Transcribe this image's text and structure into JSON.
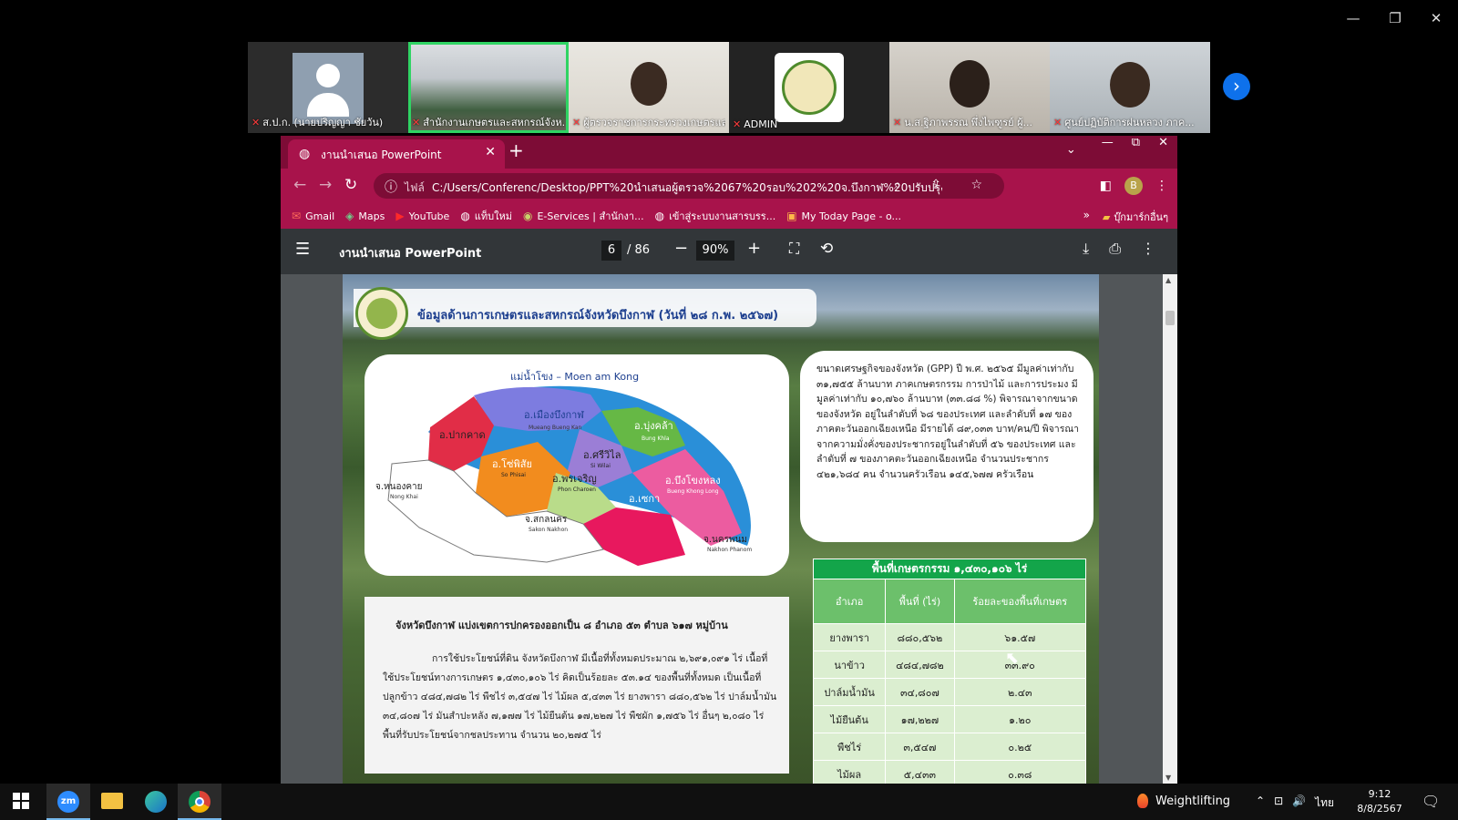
{
  "window_controls": {
    "minimize": "—",
    "restore": "❐",
    "close": "✕"
  },
  "participants": [
    {
      "name": "ส.ป.ก. (นายปริญญา ชัยวัน)"
    },
    {
      "name": "สำนักงานเกษตรและสหกรณ์จังห..."
    },
    {
      "name": "ผู้ตรวจราชการกระทรวงเกษตรแล..."
    },
    {
      "name": "ADMIN"
    },
    {
      "name": "น.ส.ฐิภาพรรณ พึ่งไพฑูรย์ ผู้..."
    },
    {
      "name": "ศูนย์ปฏิบัติการฝนหลวง ภาค..."
    }
  ],
  "next_icon": "›",
  "browser": {
    "tab_title": "งานนำเสนอ PowerPoint",
    "tab_close": "✕",
    "new_tab": "+",
    "tab_controls": {
      "dropdown": "⌄",
      "minimize": "—",
      "restore": "⧉",
      "close": "✕"
    },
    "nav": {
      "back": "←",
      "forward": "→",
      "reload": "↻"
    },
    "url_prefix": "ไฟล์",
    "url": "C:/Users/Conferenc/Desktop/PPT%20นำเสนอผู้ตรวจ%2067%20รอบ%202%20จ.บึงกาฬ%20ปรับปรุง.pdf",
    "url_icons": "⌕ ⇪ ☆",
    "profile_initial": "B",
    "bookmarks": [
      {
        "label": "Gmail",
        "icon": "✉"
      },
      {
        "label": "Maps",
        "icon": "◈"
      },
      {
        "label": "YouTube",
        "icon": "▶"
      },
      {
        "label": "แท็บใหม่",
        "icon": "◍"
      },
      {
        "label": "E-Services | สำนักงา...",
        "icon": "◉"
      },
      {
        "label": "เข้าสู่ระบบงานสารบรร...",
        "icon": "◍"
      },
      {
        "label": "My Today Page - o...",
        "icon": "▣"
      }
    ],
    "bookmarks_more": "»",
    "other_bookmarks": "บุ๊กมาร์กอื่นๆ"
  },
  "pdf": {
    "title": "งานนำเสนอ PowerPoint",
    "page_current": "6",
    "page_total": "/ 86",
    "zoom": "90%",
    "icons": {
      "menu": "☰",
      "zoom_out": "−",
      "zoom_in": "+",
      "fit": "⛶",
      "rotate": "⟲",
      "download": "⤓",
      "print": "⎙",
      "more": "⋮"
    }
  },
  "slide": {
    "heading": "ข้อมูลด้านการเกษตรและสหกรณ์จังหวัดบึงกาฬ (วันที่ ๒๘ ก.พ. ๒๕๖๗)",
    "map": {
      "river": "แม่น้ำโขง – Moen am Kong",
      "districts": [
        {
          "th": "อ.เมืองบึงกาฬ",
          "en": "Mueang Bueng Kan"
        },
        {
          "th": "อ.ปากคาด",
          "en": ""
        },
        {
          "th": "อ.บุ่งคล้า",
          "en": "Bung Khla"
        },
        {
          "th": "อ.ศรีวิไล",
          "en": "Si Wilai"
        },
        {
          "th": "อ.โซ่พิสัย",
          "en": "So Phisai"
        },
        {
          "th": "อ.พรเจริญ",
          "en": "Phon Charoen"
        },
        {
          "th": "อ.บึงโขงหลง",
          "en": "Bueng Khong Long"
        },
        {
          "th": "อ.เซกา",
          "en": ""
        }
      ],
      "neighbors": [
        {
          "th": "จ.หนองคาย",
          "en": "Nong Khai"
        },
        {
          "th": "จ.สกลนคร",
          "en": "Sakon Nakhon"
        },
        {
          "th": "จ.นครพนม",
          "en": "Nakhon Phanom"
        }
      ]
    },
    "gpp_text": "ขนาดเศรษฐกิจของจังหวัด (GPP) ปี พ.ศ. ๒๕๖๕ มีมูลค่าเท่ากับ ๓๑,๗๕๕ ล้านบาท ภาคเกษตรกรรม การป่าไม้ และการประมง มีมูลค่าเท่ากับ ๑๐,๗๖๐ ล้านบาท (๓๓.๘๘ %) พิจารณาจากขนาดของจังหวัด อยู่ในลำดับที่ ๖๘ ของประเทศ และลำดับที่ ๑๗ ของภาคตะวันออกเฉียงเหนือ มีรายได้ ๘๙,๐๓๓ บาท/คน/ปี พิจารณาจากความมั่งคั่งของประชากรอยู่ในลำดับที่ ๕๖ ของประเทศ และลำดับที่ ๗ ของภาคตะวันออกเฉียงเหนือ จำนวนประชากร ๔๒๑,๖๘๔ คน จำนวนครัวเรือน ๑๔๕,๖๗๗ ครัวเรือน",
    "table": {
      "caption": "พื้นที่เกษตรกรรม ๑,๔๓๐,๑๐๖ ไร่",
      "headers": [
        "อำเภอ",
        "พื้นที่ (ไร่)",
        "ร้อยละของพื้นที่เกษตร"
      ],
      "rows": [
        [
          "ยางพารา",
          "๘๘๐,๕๖๒",
          "๖๑.๕๗"
        ],
        [
          "นาข้าว",
          "๔๘๔,๗๘๒",
          "๓๓.๙๐"
        ],
        [
          "ปาล์มน้ำมัน",
          "๓๔,๘๐๗",
          "๒.๔๓"
        ],
        [
          "ไม้ยืนต้น",
          "๑๗,๒๒๗",
          "๑.๒๐"
        ],
        [
          "พืชไร่",
          "๓,๕๔๗",
          "๐.๒๕"
        ],
        [
          "ไม้ผล",
          "๕,๔๓๓",
          "๐.๓๘"
        ]
      ]
    },
    "info_line1": "จังหวัดบึงกาฬ แบ่งเขตการปกครองออกเป็น ๘ อำเภอ ๕๓ ตำบล ๖๑๗ หมู่บ้าน",
    "info_para": "การใช้ประโยชน์ที่ดิน จังหวัดบึงกาฬ มีเนื้อที่ทั้งหมดประมาณ ๒,๖๙๑,๐๙๑ ไร่ เนื้อที่ใช้ประโยชน์ทางการเกษตร ๑,๔๓๐,๑๐๖ ไร่ คิดเป็นร้อยละ ๕๓.๑๔ ของพื้นที่ทั้งหมด เป็นเนื้อที่ปลูกข้าว ๔๘๔,๗๘๒ ไร่ พืชไร่ ๓,๕๔๗ ไร่ ไม้ผล ๕,๔๓๓ ไร่ ยางพารา ๘๘๐,๕๖๒ ไร่ ปาล์มน้ำมัน ๓๔,๘๐๗ ไร่ มันสำปะหลัง ๗,๑๗๗ ไร่ ไม้ยืนต้น ๑๗,๒๒๗ ไร่ พืชผัก ๑,๗๕๖ ไร่ อื่นๆ ๒,๐๘๐ ไร่ พื้นที่รับประโยชน์จากชลประทาน จำนวน ๒๐,๒๗๕ ไร่"
  },
  "taskbar": {
    "apps": [
      {
        "name": "zoom",
        "label": "zm"
      },
      {
        "name": "file-explorer"
      },
      {
        "name": "edge"
      },
      {
        "name": "chrome"
      }
    ],
    "weather": "Weightlifting",
    "tray": {
      "chevron": "⌃",
      "network": "⊡",
      "volume": "🔊",
      "language": "ไทย"
    },
    "time": "9:12",
    "date": "8/8/2567",
    "notifications": "🗨"
  }
}
